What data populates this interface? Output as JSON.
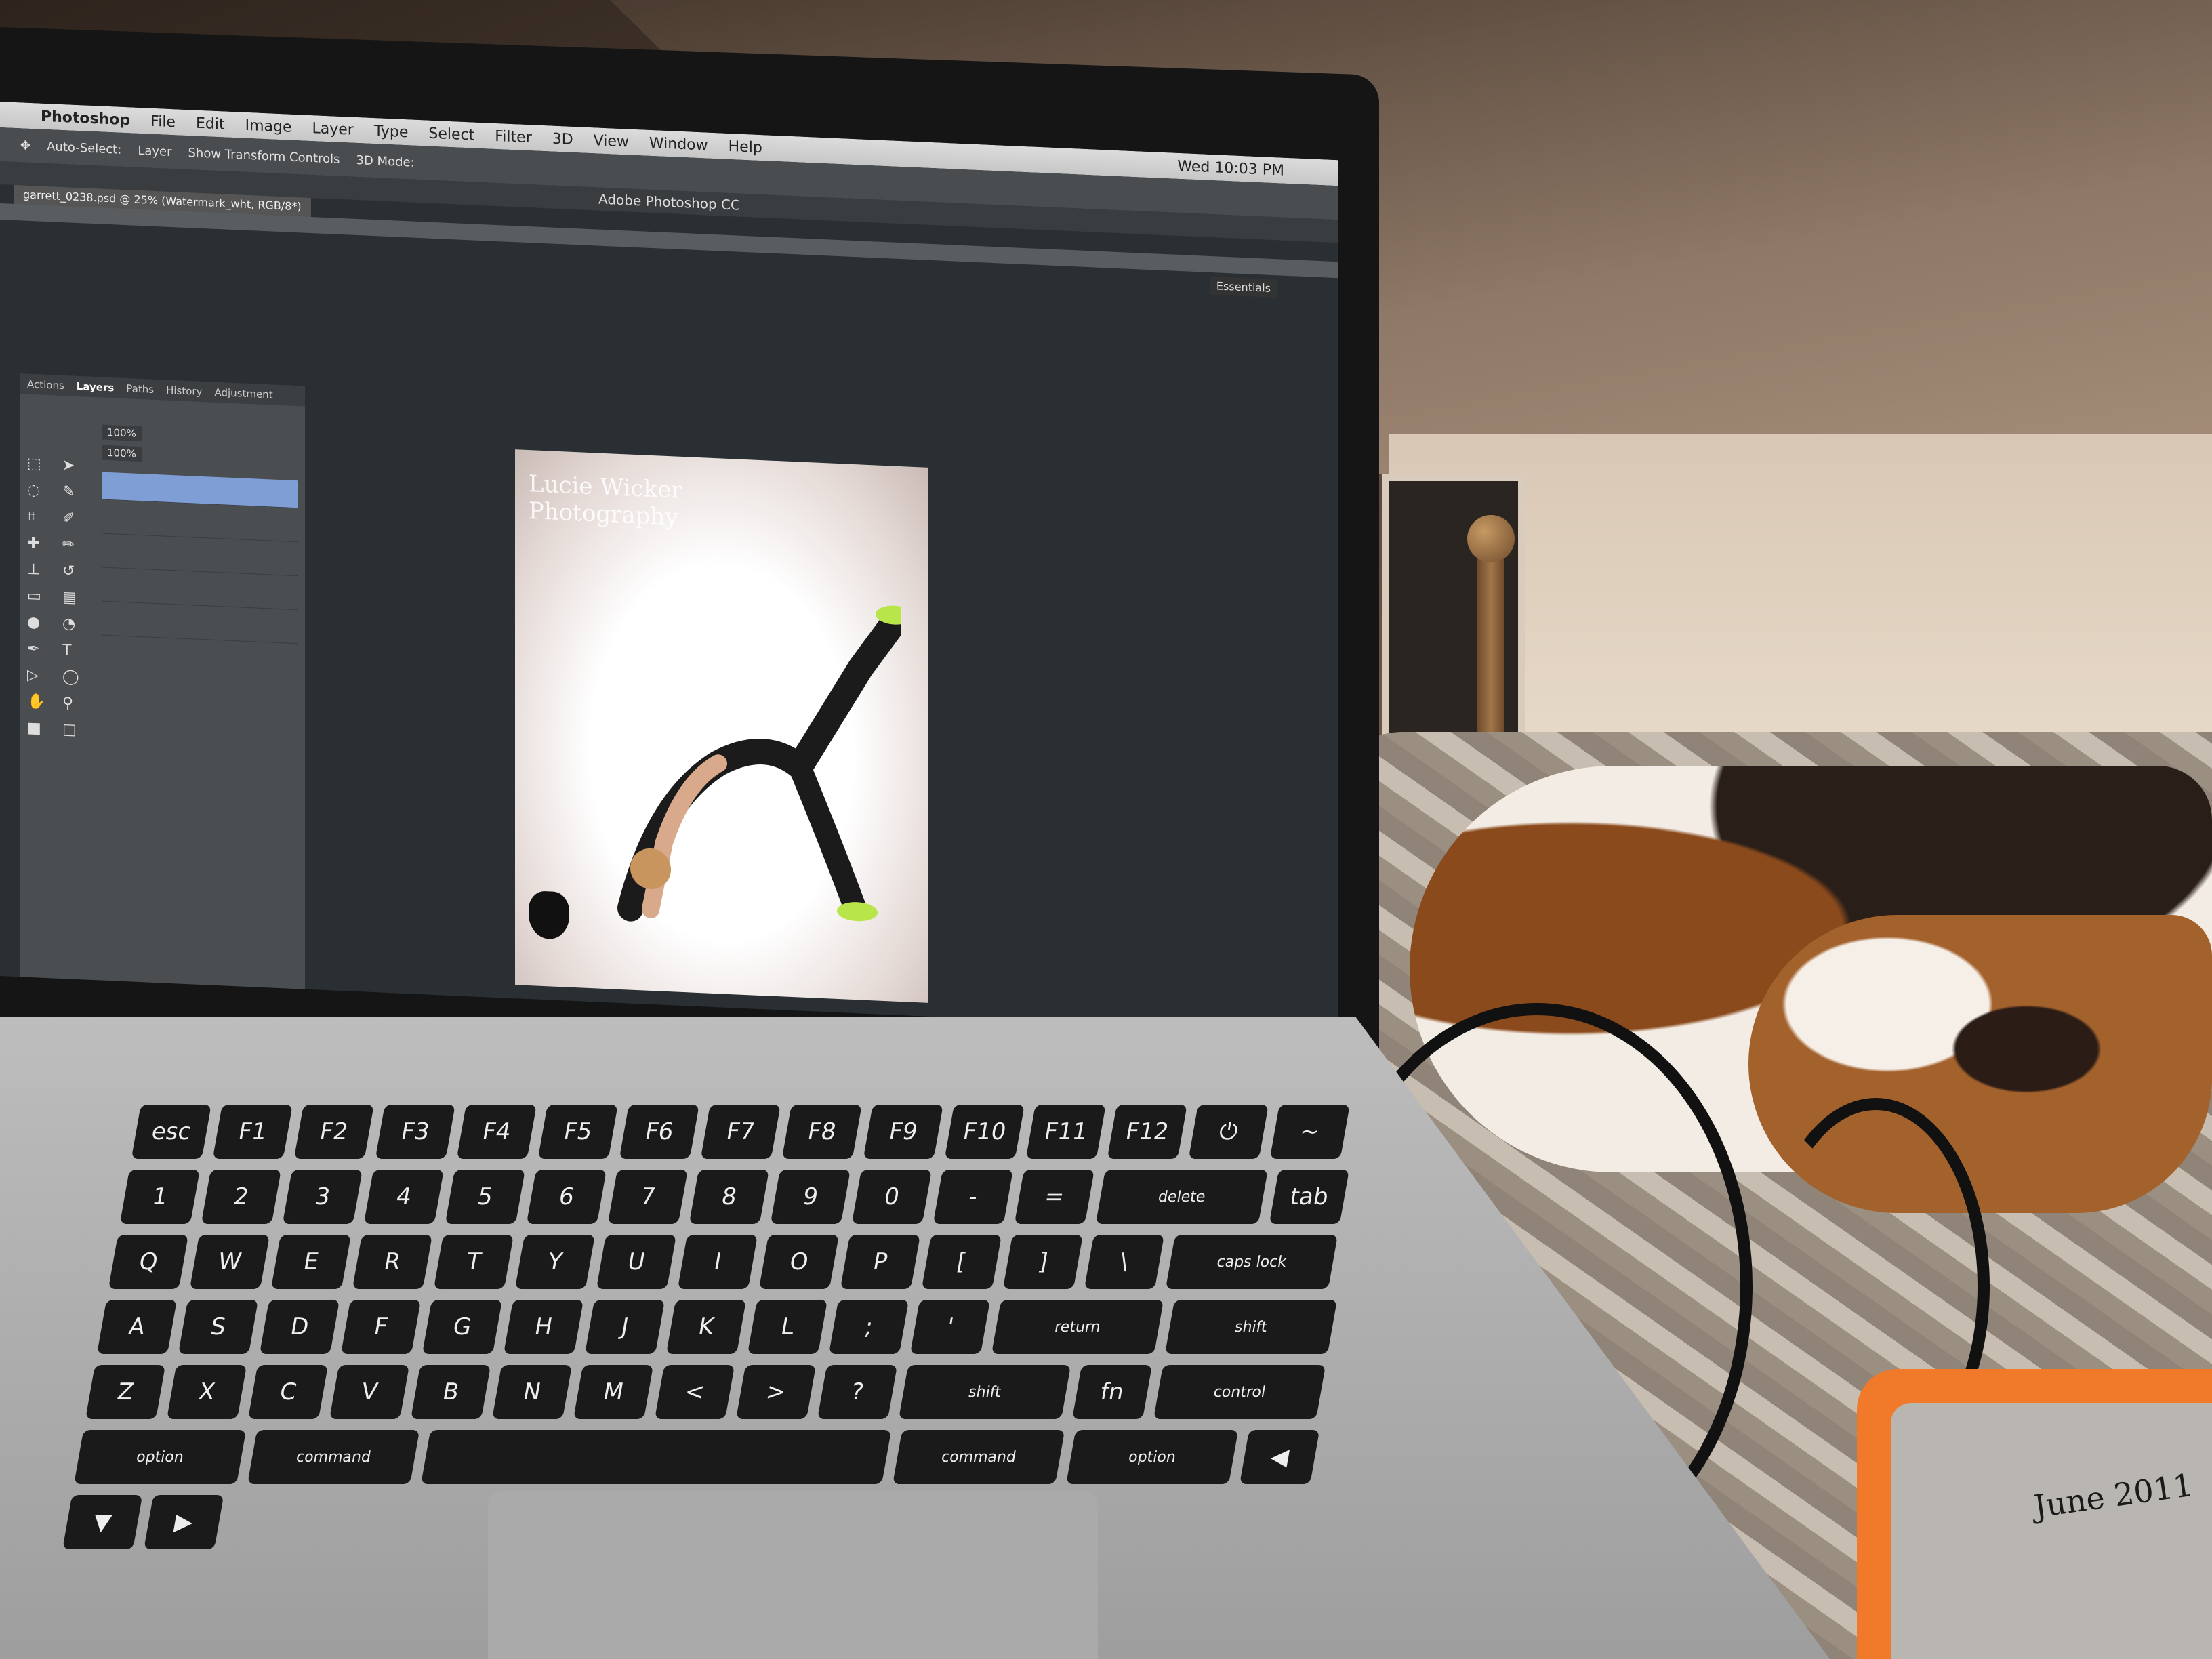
{
  "menubar": {
    "app": "Photoshop",
    "items": [
      "File",
      "Edit",
      "Image",
      "Layer",
      "Type",
      "Select",
      "Filter",
      "3D",
      "View",
      "Window",
      "Help"
    ],
    "clock": "Wed 10:03 PM"
  },
  "options": {
    "auto_select": "Auto-Select:",
    "layer": "Layer",
    "transform": "Show Transform Controls",
    "mode3d": "3D Mode:"
  },
  "window_title": "Adobe Photoshop CC",
  "doc_tab": "garrett_0238.psd @ 25% (Watermark_wht, RGB/8*)",
  "workspace": "Essentials",
  "panel": {
    "tabs": [
      "Actions",
      "Layers",
      "Paths",
      "History",
      "Adjustment"
    ],
    "opacity": "100%",
    "fill": "100%"
  },
  "watermark": [
    "Lucie Wicker",
    "Photography"
  ],
  "drive_note": "June 2011",
  "keyboard_rows": [
    [
      "esc",
      "F1",
      "F2",
      "F3",
      "F4",
      "F5",
      "F6",
      "F7",
      "F8",
      "F9",
      "F10",
      "F11",
      "F12",
      "⏻"
    ],
    [
      "~",
      "1",
      "2",
      "3",
      "4",
      "5",
      "6",
      "7",
      "8",
      "9",
      "0",
      "-",
      "=",
      "delete"
    ],
    [
      "tab",
      "Q",
      "W",
      "E",
      "R",
      "T",
      "Y",
      "U",
      "I",
      "O",
      "P",
      "[",
      "]",
      "\\"
    ],
    [
      "caps lock",
      "A",
      "S",
      "D",
      "F",
      "G",
      "H",
      "J",
      "K",
      "L",
      ";",
      "'",
      "return"
    ],
    [
      "shift",
      "Z",
      "X",
      "C",
      "V",
      "B",
      "N",
      "M",
      "<",
      ">",
      "?",
      "shift"
    ],
    [
      "fn",
      "control",
      "option",
      "command",
      "",
      "command",
      "option",
      "◀",
      "▼",
      "▶"
    ]
  ],
  "colors": {
    "accent_selected_layer": "#7f9ed6",
    "drive_orange": "#f07a2a",
    "dog_brown": "#a3612c"
  }
}
